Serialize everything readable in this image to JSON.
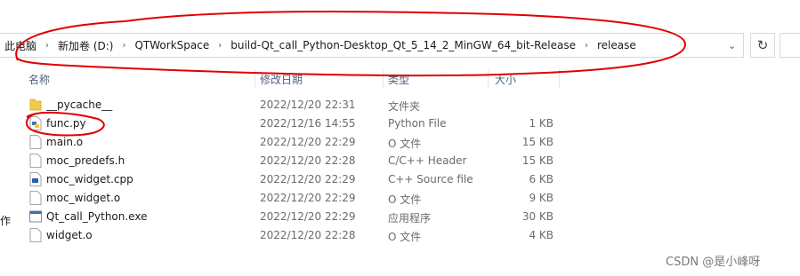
{
  "address_bar": {
    "crumbs": [
      "此电脑",
      "新加卷 (D:)",
      "QTWorkSpace",
      "build-Qt_call_Python-Desktop_Qt_5_14_2_MinGW_64_bit-Release",
      "release"
    ]
  },
  "columns": {
    "name": "名称",
    "date": "修改日期",
    "type": "类型",
    "size": "大小"
  },
  "files": [
    {
      "name": "__pycache__",
      "date": "2022/12/20 22:31",
      "type": "文件夹",
      "size": "",
      "icon": "folder-icon"
    },
    {
      "name": "func.py",
      "date": "2022/12/16 14:55",
      "type": "Python File",
      "size": "1 KB",
      "icon": "python-file-icon"
    },
    {
      "name": "main.o",
      "date": "2022/12/20 22:29",
      "type": "O 文件",
      "size": "15 KB",
      "icon": "file-icon"
    },
    {
      "name": "moc_predefs.h",
      "date": "2022/12/20 22:28",
      "type": "C/C++ Header",
      "size": "15 KB",
      "icon": "file-icon"
    },
    {
      "name": "moc_widget.cpp",
      "date": "2022/12/20 22:29",
      "type": "C++ Source file",
      "size": "6 KB",
      "icon": "cpp-file-icon"
    },
    {
      "name": "moc_widget.o",
      "date": "2022/12/20 22:29",
      "type": "O 文件",
      "size": "9 KB",
      "icon": "file-icon"
    },
    {
      "name": "Qt_call_Python.exe",
      "date": "2022/12/20 22:29",
      "type": "应用程序",
      "size": "30 KB",
      "icon": "exe-icon"
    },
    {
      "name": "widget.o",
      "date": "2022/12/20 22:28",
      "type": "O 文件",
      "size": "4 KB",
      "icon": "file-icon"
    }
  ],
  "left_pane_fragment": "作",
  "watermark": "CSDN @是小峰呀",
  "annotation_color": "#e00000"
}
